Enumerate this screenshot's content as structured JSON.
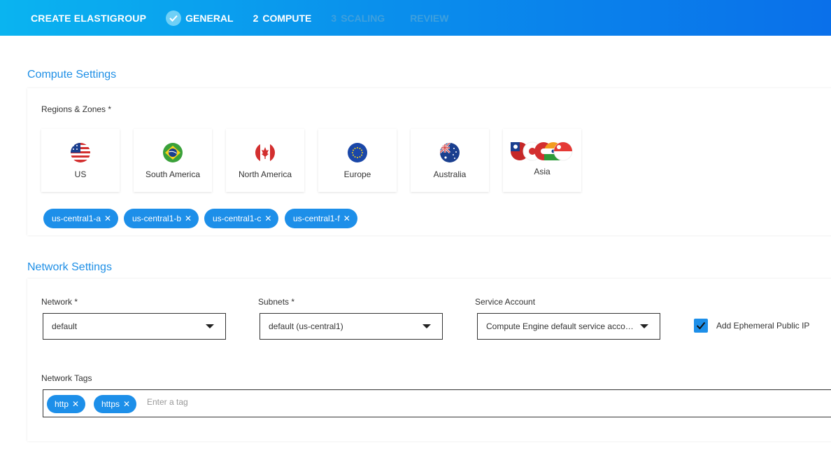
{
  "header": {
    "title": "CREATE ELASTIGROUP",
    "steps": [
      {
        "number": "",
        "label": "GENERAL",
        "state": "done"
      },
      {
        "number": "2",
        "label": "COMPUTE",
        "state": "active"
      },
      {
        "number": "3",
        "label": "SCALING",
        "state": "pending"
      },
      {
        "number": "",
        "label": "REVIEW",
        "state": "pending"
      }
    ]
  },
  "compute": {
    "title": "Compute Settings",
    "regions_label": "Regions & Zones *",
    "regions": [
      {
        "name": "US",
        "flag": "us-flag-icon"
      },
      {
        "name": "South America",
        "flag": "brazil-flag-icon"
      },
      {
        "name": "North America",
        "flag": "canada-flag-icon"
      },
      {
        "name": "Europe",
        "flag": "eu-flag-icon"
      },
      {
        "name": "Australia",
        "flag": "australia-flag-icon"
      },
      {
        "name": "Asia",
        "flag": "asia-flags-icon"
      }
    ],
    "zones": [
      "us-central1-a",
      "us-central1-b",
      "us-central1-c",
      "us-central1-f"
    ]
  },
  "network": {
    "title": "Network Settings",
    "network_label": "Network *",
    "network_value": "default",
    "subnets_label": "Subnets *",
    "subnets_value": "default (us-central1)",
    "service_account_label": "Service Account",
    "service_account_value": "Compute Engine default service account",
    "ephemeral_ip_label": "Add Ephemeral Public IP",
    "ephemeral_ip_checked": true,
    "tags_label": "Network Tags",
    "tags": [
      "http",
      "https"
    ],
    "tags_placeholder": "Enter a tag"
  },
  "colors": {
    "accent": "#1d8fe9",
    "header_start": "#0ab4f0",
    "header_end": "#0a70ea"
  }
}
